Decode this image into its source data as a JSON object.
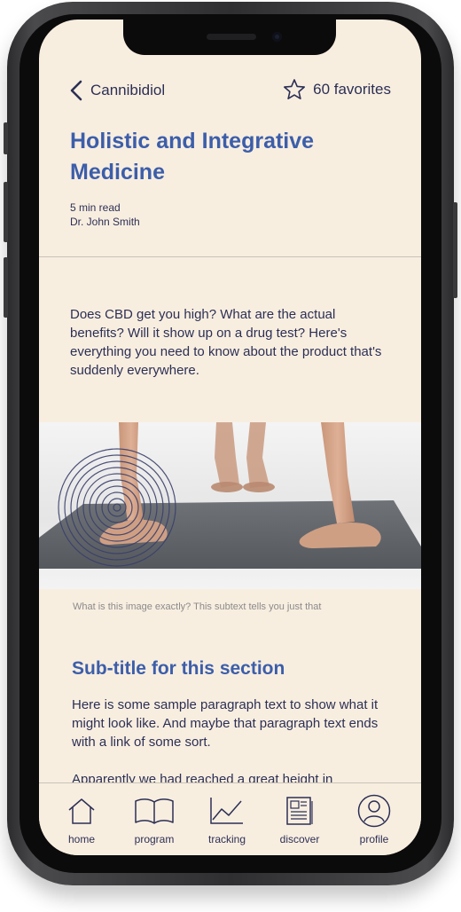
{
  "header": {
    "back_label": "Cannibidiol",
    "favorites_label": "60 favorites"
  },
  "article": {
    "title": "Holistic and Integrative Medicine",
    "read_time": "5 min read",
    "author": "Dr. John Smith",
    "intro": "Does CBD get you high? What are the actual benefits? Will it show up on a drug test? Here's everything you need to know about the product that's suddenly everywhere.",
    "image_caption": "What is this image exactly? This subtext tells you just that",
    "subtitle": "Sub-title for this section",
    "paragraph": "Here is some sample paragraph text to show what it might look like. And maybe that paragraph text ends with a link of some sort.",
    "paragraph2": "Apparently we had reached a great height in"
  },
  "tabs": [
    {
      "label": "home",
      "icon": "home-icon"
    },
    {
      "label": "program",
      "icon": "book-icon"
    },
    {
      "label": "tracking",
      "icon": "chart-icon"
    },
    {
      "label": "discover",
      "icon": "newspaper-icon"
    },
    {
      "label": "profile",
      "icon": "person-icon"
    }
  ],
  "colors": {
    "background": "#f8eee0",
    "accent": "#3c5eaa",
    "text": "#2c2f55"
  }
}
